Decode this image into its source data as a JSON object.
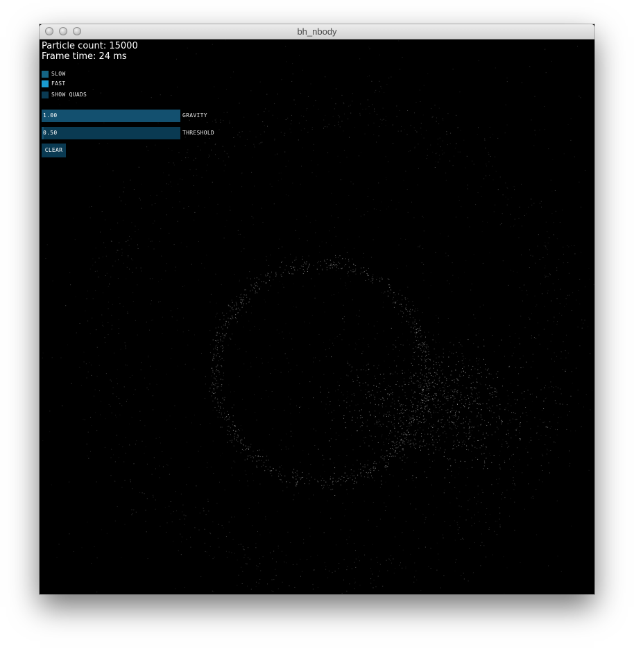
{
  "window": {
    "title": "bh_nbody"
  },
  "stats": {
    "particle_count": "Particle count: 15000",
    "frame_time": "Frame time: 24 ms"
  },
  "gui": {
    "toggles": [
      {
        "label": "SLOW",
        "checked": false
      },
      {
        "label": "FAST",
        "checked": true
      },
      {
        "label": "SHOW QUADS",
        "checked": false
      }
    ],
    "sliders": [
      {
        "label": "GRAVITY",
        "value_text": "1.00",
        "fraction": 1.0
      },
      {
        "label": "THRESHOLD",
        "value_text": "0.50",
        "fraction": 0.0
      }
    ],
    "clear_button": "CLEAR"
  },
  "colors": {
    "background": "#000000",
    "particle": "#ffffff",
    "control_off": "#0a3a52",
    "control_on": "#1a9bd0",
    "slider_fill": "#13506f"
  }
}
